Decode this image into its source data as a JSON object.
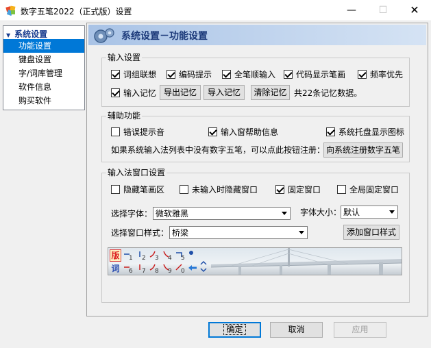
{
  "window": {
    "title": "数字五笔2022（正式版）设置",
    "minimize_glyph": "—",
    "maximize_glyph": "☐",
    "close_glyph": "✕"
  },
  "nav": {
    "root_label": "系统设置",
    "items": [
      {
        "label": "功能设置",
        "selected": true
      },
      {
        "label": "键盘设置",
        "selected": false
      },
      {
        "label": "字/词库管理",
        "selected": false
      },
      {
        "label": "软件信息",
        "selected": false
      },
      {
        "label": "购买软件",
        "selected": false
      }
    ]
  },
  "banner": {
    "title": "系统设置－功能设置"
  },
  "input_settings": {
    "legend": "输入设置",
    "options": [
      {
        "label": "词组联想",
        "checked": true
      },
      {
        "label": "编码提示",
        "checked": true
      },
      {
        "label": "全笔顺输入",
        "checked": true
      },
      {
        "label": "代码显示笔画",
        "checked": true
      },
      {
        "label": "频率优先",
        "checked": true
      },
      {
        "label": "输入记忆",
        "checked": true
      }
    ],
    "export_memory": "导出记忆",
    "import_memory": "导入记忆",
    "clear_memory": "清除记忆",
    "memory_count_text": "共22条记忆数据。"
  },
  "aux_settings": {
    "legend": "辅助功能",
    "options": [
      {
        "label": "错误提示音",
        "checked": false
      },
      {
        "label": "输入窗帮助信息",
        "checked": true
      },
      {
        "label": "系统托盘显示图标",
        "checked": true
      }
    ],
    "register_hint": "如果系统输入法列表中没有数字五笔，可以点此按钮注册：",
    "register_button": "向系统注册数字五笔"
  },
  "ime_window": {
    "legend": "输入法窗口设置",
    "options": [
      {
        "label": "隐藏笔画区",
        "checked": false
      },
      {
        "label": "未输入时隐藏窗口",
        "checked": false
      },
      {
        "label": "固定窗口",
        "checked": true
      },
      {
        "label": "全局固定窗口",
        "checked": false
      }
    ],
    "font_label": "选择字体：",
    "font_value": "微软雅黑",
    "size_label": "字体大小：",
    "size_value": "默认",
    "style_label": "选择窗口样式：",
    "style_value": "桥梁",
    "add_style_button": "添加窗口样式",
    "preview_keys_top": [
      "1",
      "2",
      "3",
      "4",
      "5"
    ],
    "preview_keys_bottom": [
      "6",
      "7",
      "8",
      "9",
      "0"
    ]
  },
  "footer": {
    "ok": "确定",
    "cancel": "取消",
    "apply": "应用"
  }
}
